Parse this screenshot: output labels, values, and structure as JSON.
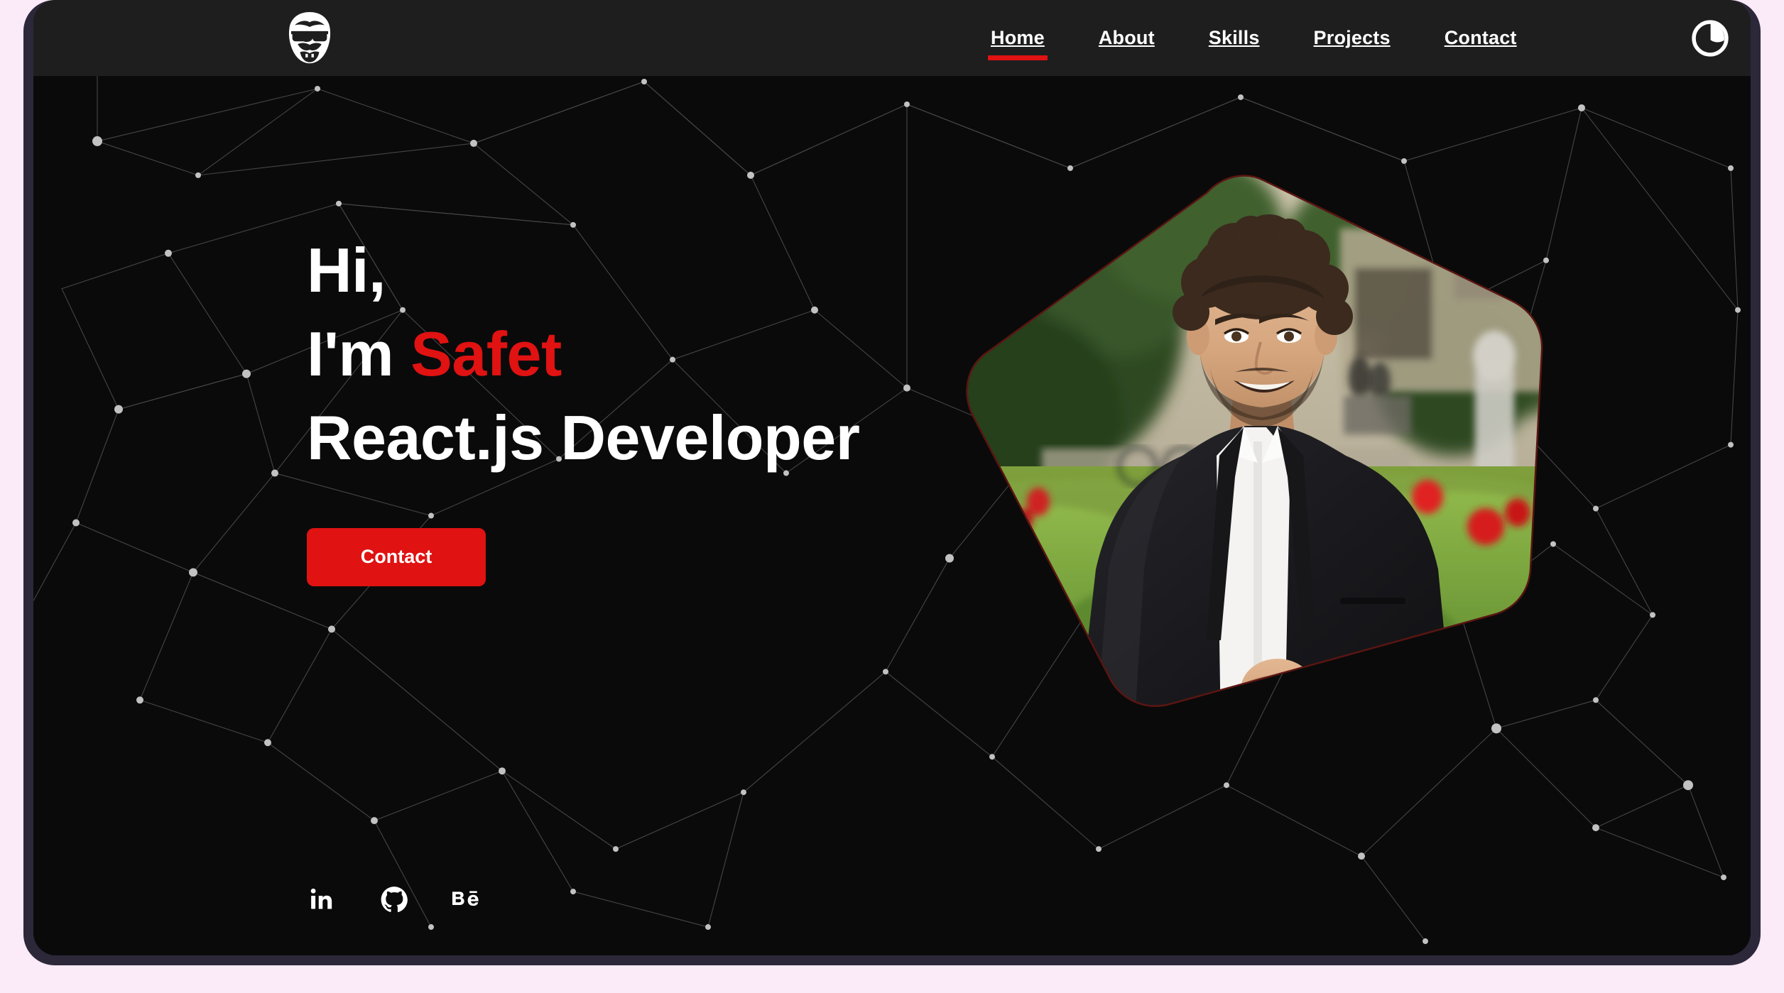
{
  "page": {
    "background_color": "#fbeaf7",
    "frame_color": "#2c2839",
    "content_background": "#0a0a0a",
    "accent_color": "#e01212"
  },
  "navbar": {
    "background_color": "#1e1e1e",
    "logo_name": "hipster-face-logo",
    "links": [
      {
        "label": "Home",
        "active": true
      },
      {
        "label": "About",
        "active": false
      },
      {
        "label": "Skills",
        "active": false
      },
      {
        "label": "Projects",
        "active": false
      },
      {
        "label": "Contact",
        "active": false
      }
    ],
    "theme_toggle": {
      "icon": "dark-mode-contrast-icon",
      "label": "Toggle dark mode"
    }
  },
  "hero": {
    "greeting": "Hi,",
    "intro_prefix": "I'm ",
    "name": "Safet",
    "role": "React.js Developer",
    "cta": {
      "label": "Contact"
    },
    "portrait": {
      "alt": "Portrait of Safet smiling in a dark suit and white shirt standing in a green park",
      "shape": "rounded-pentagon-blob"
    },
    "socials": [
      {
        "name": "linkedin",
        "label": "in"
      },
      {
        "name": "github",
        "label": "GitHub"
      },
      {
        "name": "behance",
        "label": "Bē"
      }
    ],
    "background": {
      "style": "particle-network",
      "dot_color": "#b9b9b9",
      "line_color": "#555555"
    }
  }
}
